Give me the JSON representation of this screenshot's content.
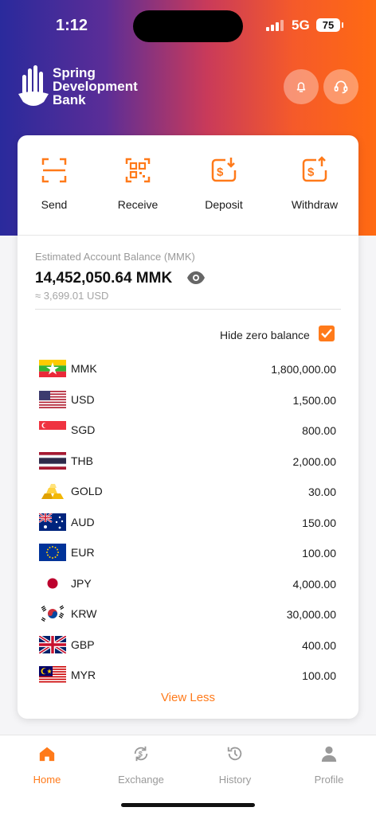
{
  "status": {
    "time": "1:12",
    "network": "5G",
    "battery": "75"
  },
  "brand": {
    "name": "Spring\nDevelopment\nBank"
  },
  "actions": [
    {
      "label": "Send",
      "icon": "scan-icon"
    },
    {
      "label": "Receive",
      "icon": "qr-code-icon"
    },
    {
      "label": "Deposit",
      "icon": "deposit-icon"
    },
    {
      "label": "Withdraw",
      "icon": "withdraw-icon"
    }
  ],
  "balance": {
    "label": "Estimated Account Balance (MMK)",
    "value": "14,452,050.64 MMK",
    "usd": "≈ 3,699.01 USD"
  },
  "hide_zero": {
    "label": "Hide zero balance",
    "checked": true
  },
  "currencies": [
    {
      "code": "MMK",
      "amount": "1,800,000.00"
    },
    {
      "code": "USD",
      "amount": "1,500.00"
    },
    {
      "code": "SGD",
      "amount": "800.00"
    },
    {
      "code": "THB",
      "amount": "2,000.00"
    },
    {
      "code": "GOLD",
      "amount": "30.00"
    },
    {
      "code": "AUD",
      "amount": "150.00"
    },
    {
      "code": "EUR",
      "amount": "100.00"
    },
    {
      "code": "JPY",
      "amount": "4,000.00"
    },
    {
      "code": "KRW",
      "amount": "30,000.00"
    },
    {
      "code": "GBP",
      "amount": "400.00"
    },
    {
      "code": "MYR",
      "amount": "100.00"
    }
  ],
  "view_less": "View Less",
  "tabs": [
    {
      "label": "Home",
      "active": true
    },
    {
      "label": "Exchange",
      "active": false
    },
    {
      "label": "History",
      "active": false
    },
    {
      "label": "Profile",
      "active": false
    }
  ],
  "colors": {
    "accent": "#ff7a1a",
    "muted": "#9a9a9a"
  }
}
